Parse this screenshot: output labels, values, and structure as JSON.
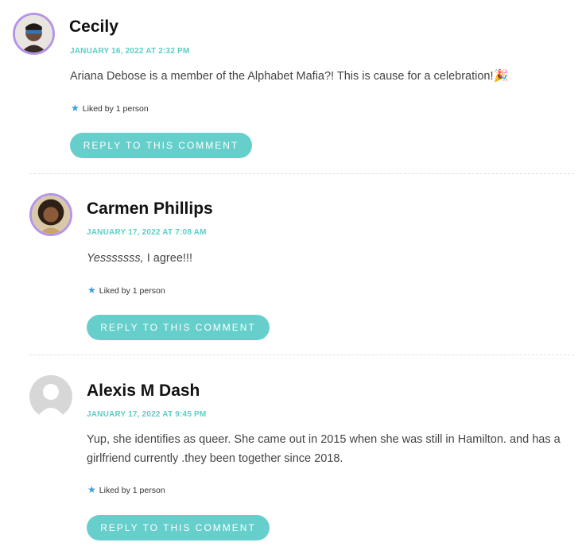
{
  "comments": [
    {
      "author": "Cecily",
      "date": "JANUARY 16, 2022 AT 2:32 PM",
      "body": "Ariana Debose is a member of the Alphabet Mafia?! This is cause for a celebration!",
      "emoji": "🎉",
      "likes": "Liked by 1 person",
      "reply_label": "REPLY TO THIS COMMENT"
    },
    {
      "author": "Carmen Phillips",
      "date": "JANUARY 17, 2022 AT 7:08 AM",
      "body_em": "Yesssssss,",
      "body": " I agree!!!",
      "likes": "Liked by 1 person",
      "reply_label": "REPLY TO THIS COMMENT"
    },
    {
      "author": "Alexis M Dash",
      "date": "JANUARY 17, 2022 AT 9:45 PM",
      "body_line1": "Yup, she identifies as queer. She came out in 2015 when she was still in Hamilton. and has a",
      "body_line2": "girlfriend currently .they been together since 2018.",
      "likes": "Liked by 1 person",
      "reply_label": "REPLY TO THIS COMMENT"
    }
  ],
  "colors": {
    "accent": "#66cfcb",
    "date": "#5ccec6",
    "avatar_ring": "#b495e8",
    "star": "#3b9fd8"
  },
  "icons": {
    "like": "star-icon",
    "default_avatar": "default-user-avatar-icon"
  }
}
